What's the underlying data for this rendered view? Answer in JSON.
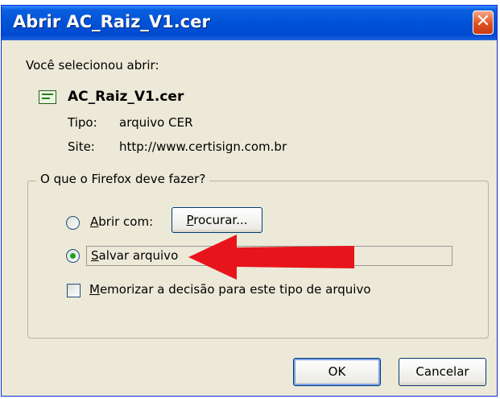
{
  "window": {
    "title": "Abrir AC_Raiz_V1.cer",
    "close_symbol": "✕"
  },
  "file": {
    "intro": "Você selecionou abrir:",
    "icon": "certificate-file-icon",
    "name": "AC_Raiz_V1.cer",
    "type_label": "Tipo:",
    "type_value": "arquivo CER",
    "site_label": "Site:",
    "site_value": "http://www.certisign.com.br"
  },
  "action_group": {
    "title": "O que o Firefox deve fazer?",
    "open_with": {
      "access_key": "A",
      "rest": "brir com:",
      "checked": false
    },
    "browse_button": {
      "access_key": "P",
      "rest": "rocurar..."
    },
    "save_file": {
      "access_key": "S",
      "rest": "alvar arquivo",
      "checked": true
    },
    "remember": {
      "access_key": "M",
      "rest": "emorizar a decisão para este tipo de arquivo",
      "checked": false
    }
  },
  "buttons": {
    "ok": "OK",
    "cancel": "Cancelar"
  },
  "colors": {
    "title_bar": "#0052d6",
    "dialog_bg": "#ece9d8",
    "annotation_arrow": "#e8141b"
  }
}
